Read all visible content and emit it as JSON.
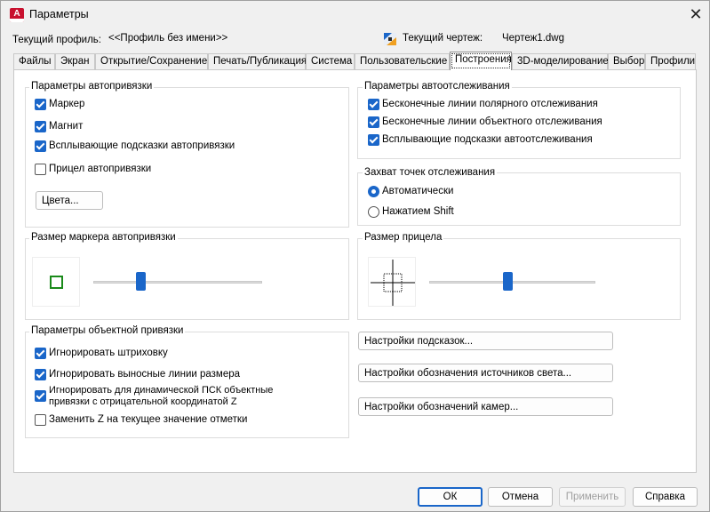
{
  "window": {
    "title": "Параметры",
    "app_icon_letter": "A",
    "close_symbol": "✕"
  },
  "profile": {
    "label": "Текущий профиль:",
    "value": "<<Профиль без имени>>",
    "drawing_label": "Текущий чертеж:",
    "drawing_value": "Чертеж1.dwg"
  },
  "tabs": [
    {
      "label": "Файлы",
      "active": false
    },
    {
      "label": "Экран",
      "active": false
    },
    {
      "label": "Открытие/Сохранение",
      "active": false
    },
    {
      "label": "Печать/Публикация",
      "active": false
    },
    {
      "label": "Система",
      "active": false
    },
    {
      "label": "Пользовательские",
      "active": false
    },
    {
      "label": "Построения",
      "active": true
    },
    {
      "label": "3D-моделирование",
      "active": false
    },
    {
      "label": "Выбор",
      "active": false
    },
    {
      "label": "Профили",
      "active": false
    }
  ],
  "autosnap": {
    "title": "Параметры автопривязки",
    "items": [
      {
        "label": "Маркер",
        "checked": true
      },
      {
        "label": "Магнит",
        "checked": true
      },
      {
        "label": "Всплывающие подсказки автопривязки",
        "checked": true
      },
      {
        "label": "Прицел автопривязки",
        "checked": false
      }
    ],
    "colors_button": "Цвета..."
  },
  "marker_size": {
    "title": "Размер маркера автопривязки",
    "slider_fraction": 0.27,
    "marker_color": "#1a8a1a"
  },
  "osnap": {
    "title": "Параметры объектной привязки",
    "items": [
      {
        "label": "Игнорировать штриховку",
        "checked": true
      },
      {
        "label": "Игнорировать выносные линии размера",
        "checked": true
      },
      {
        "label": "Игнорировать для динамической ПСК объектные",
        "label2": "привязки с отрицательной координатой Z",
        "checked": true
      },
      {
        "label": "Заменить Z на текущее значение отметки",
        "checked": false
      }
    ]
  },
  "autotrack": {
    "title": "Параметры автоотслеживания",
    "items": [
      {
        "label": "Бесконечные линии полярного отслеживания",
        "checked": true
      },
      {
        "label": "Бесконечные линии объектного отслеживания",
        "checked": true
      },
      {
        "label": "Всплывающие подсказки автоотслеживания",
        "checked": true
      }
    ]
  },
  "acquire": {
    "title": "Захват точек отслеживания",
    "options": [
      {
        "label": "Автоматически",
        "selected": true
      },
      {
        "label": "Нажатием Shift",
        "selected": false
      }
    ]
  },
  "aperture": {
    "title": "Размер прицела",
    "slider_fraction": 0.47
  },
  "settings_buttons": [
    "Настройки подсказок...",
    "Настройки обозначения источников света...",
    "Настройки обозначений камер..."
  ],
  "footer": {
    "ok": "ОК",
    "cancel": "Отмена",
    "apply": "Применить",
    "help": "Справка"
  },
  "colors": {
    "accent": "#1a66c9"
  }
}
